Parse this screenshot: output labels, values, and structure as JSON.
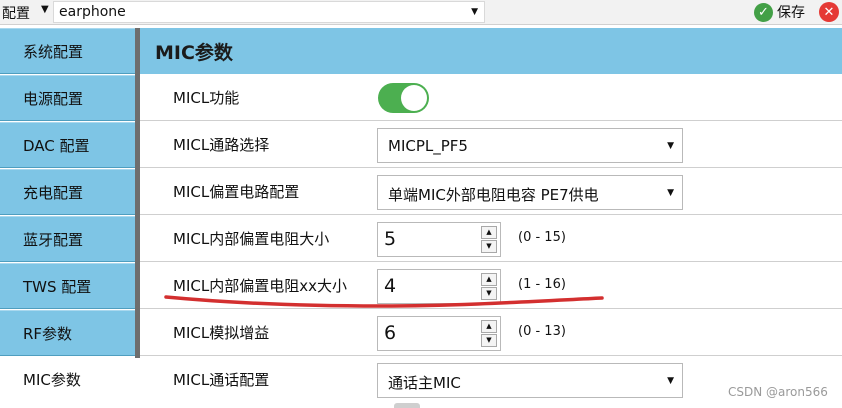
{
  "toolbar": {
    "config_label": "配置",
    "profile_value": "earphone",
    "save_label": "保存",
    "save_icon": "check-circle-icon",
    "close_icon": "close-circle-icon"
  },
  "sidebar": {
    "items": [
      {
        "label": "系统配置"
      },
      {
        "label": "电源配置"
      },
      {
        "label": "DAC 配置"
      },
      {
        "label": "充电配置"
      },
      {
        "label": "蓝牙配置"
      },
      {
        "label": "TWS 配置"
      },
      {
        "label": "RF参数"
      },
      {
        "label": "MIC参数"
      }
    ],
    "active": "MIC参数"
  },
  "main": {
    "title": "MIC参数",
    "rows": [
      {
        "label": "MICL功能",
        "control": "toggle",
        "on": true
      },
      {
        "label": "MICL通路选择",
        "control": "dropdown",
        "value": "MICPL_PF5"
      },
      {
        "label": "MICL偏置电路配置",
        "control": "dropdown",
        "value": "单端MIC外部电阻电容 PE7供电"
      },
      {
        "label": "MICL内部偏置电阻大小",
        "control": "spinner",
        "value": "5",
        "range": "(0 - 15)"
      },
      {
        "label": "MICL内部偏置电阻xx大小",
        "control": "spinner",
        "value": "4",
        "range": "(1 - 16)"
      },
      {
        "label": "MICL模拟增益",
        "control": "spinner",
        "value": "6",
        "range": "(0 - 13)"
      },
      {
        "label": "MICL通话配置",
        "control": "dropdown",
        "value": "通话主MIC"
      }
    ]
  },
  "colors": {
    "sidebar_bg": "#7ec5e5",
    "toggle_on": "#4caf50",
    "annotation": "#d32f2f"
  },
  "watermark": "CSDN @aron566"
}
